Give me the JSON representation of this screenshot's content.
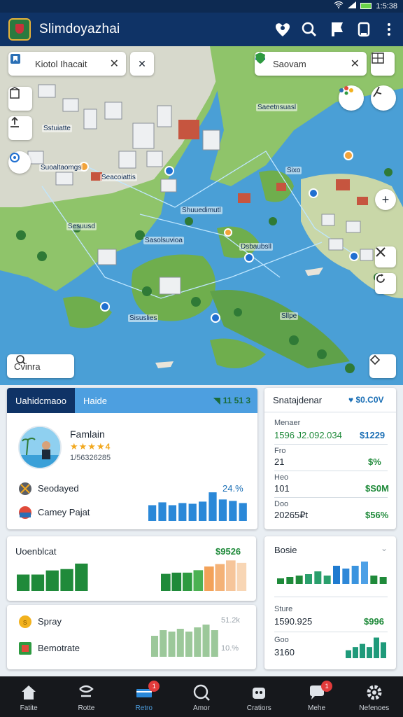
{
  "status_bar": {
    "time": "1:5:38"
  },
  "app": {
    "title": "Slimdoyazhai"
  },
  "map": {
    "search_left": {
      "value": "Kiotol Ihacait"
    },
    "search_right": {
      "value": "Saovam"
    },
    "search_bottom": {
      "value": "Cvinra"
    },
    "labels": [
      "Sstuiatte",
      "Suoaltaomgs",
      "Seacoiattis",
      "Shuuedimutl",
      "Sesuusd",
      "Sasolsuvioa",
      "Saeetnsuasl",
      "Dsbaubsll",
      "Sixo",
      "Sisuslies",
      "Sllpe"
    ]
  },
  "profile_panel": {
    "tab_active": "Uahidcmaoo",
    "tab_inactive": "Haide",
    "tab_value": "11 51 3",
    "name": "Famlain",
    "stars": "★★★★",
    "rating_text": "4",
    "sub": "1/56326285",
    "row1_label": "Seodayed",
    "row1_value": "24.%",
    "row2_label": "Camey Pajat",
    "chart_data": {
      "type": "bar",
      "categories": [
        "1",
        "2",
        "3",
        "4",
        "5",
        "6",
        "7",
        "8",
        "9",
        "10"
      ],
      "values": [
        22,
        26,
        22,
        25,
        24,
        27,
        40,
        30,
        28,
        25
      ],
      "ylim": [
        0,
        45
      ]
    }
  },
  "summary_panel": {
    "title": "Snatajdenar",
    "header_value": "$0.C0V",
    "rows": [
      {
        "label": "Menaer",
        "left": "1596 J2.092.034",
        "right": "$1229"
      },
      {
        "label": "Fro",
        "left": "21",
        "right": "$%"
      },
      {
        "label": "Heo",
        "left": "101",
        "right": "$S0M"
      },
      {
        "label": "Doo",
        "left": "20265₽t",
        "right": "$56%"
      }
    ]
  },
  "sales_panel": {
    "title": "Uoenblcat",
    "value": "$9526",
    "chart_left": {
      "type": "bar",
      "categories": [
        "1",
        "2",
        "3",
        "4",
        "5"
      ],
      "values": [
        24,
        24,
        30,
        32,
        40
      ],
      "ylim": [
        0,
        45
      ]
    },
    "chart_right": {
      "type": "bar",
      "categories": [
        "1",
        "2",
        "3",
        "4",
        "5",
        "6",
        "7",
        "8"
      ],
      "values": [
        28,
        30,
        30,
        34,
        40,
        44,
        50,
        46
      ],
      "ylim": [
        0,
        55
      ],
      "colors": [
        "#1f8a3a",
        "#1f8a3a",
        "#2e9a40",
        "#4bb152",
        "#f3a259",
        "#f4b277",
        "#f6c59a",
        "#f8d6b5"
      ]
    }
  },
  "spray_panel": {
    "row1_label": "Spray",
    "row1_value": "51.2k",
    "row2_label": "Bemotrate",
    "row2_value": "10.%",
    "chart_data": {
      "type": "bar",
      "categories": [
        "1",
        "2",
        "3",
        "4",
        "5",
        "6",
        "7",
        "8"
      ],
      "values": [
        30,
        38,
        36,
        40,
        36,
        42,
        46,
        38
      ],
      "ylim": [
        0,
        50
      ]
    }
  },
  "stats_panel": {
    "title": "Bosie",
    "row1_label": "Sture",
    "row1_left": "1590.925",
    "row1_right": "$996",
    "row2_label": "Goo",
    "row2_left": "3160",
    "chart_top": {
      "type": "bar",
      "categories": [
        "1",
        "2",
        "3",
        "4",
        "5",
        "6",
        "7",
        "8",
        "9",
        "10",
        "11",
        "12"
      ],
      "values": [
        8,
        10,
        12,
        14,
        18,
        12,
        26,
        22,
        26,
        32,
        12,
        10
      ],
      "ylim": [
        0,
        40
      ],
      "colors": [
        "#1f8a3a",
        "#1f8a3a",
        "#1f8a3a",
        "#2a9f6c",
        "#2a9f6c",
        "#2a9f6c",
        "#1f7bd0",
        "#2e88d8",
        "#3a94df",
        "#4da0e6",
        "#1f8a3a",
        "#1f8a3a"
      ]
    },
    "chart_bottom": {
      "type": "bar",
      "categories": [
        "1",
        "2",
        "3",
        "4",
        "5",
        "6"
      ],
      "values": [
        10,
        14,
        18,
        14,
        26,
        20
      ],
      "ylim": [
        0,
        30
      ]
    }
  },
  "bottom_nav": [
    {
      "label": "Fatite",
      "icon": "home-icon",
      "badge": ""
    },
    {
      "label": "Rotte",
      "icon": "route-icon",
      "badge": ""
    },
    {
      "label": "Retro",
      "icon": "card-icon",
      "badge": "1",
      "active": true
    },
    {
      "label": "Amor",
      "icon": "search-icon",
      "badge": ""
    },
    {
      "label": "Cratiors",
      "icon": "robot-icon",
      "badge": ""
    },
    {
      "label": "Mehe",
      "icon": "chat-icon",
      "badge": "1"
    },
    {
      "label": "Nefenoes",
      "icon": "gear-icon",
      "badge": ""
    }
  ]
}
